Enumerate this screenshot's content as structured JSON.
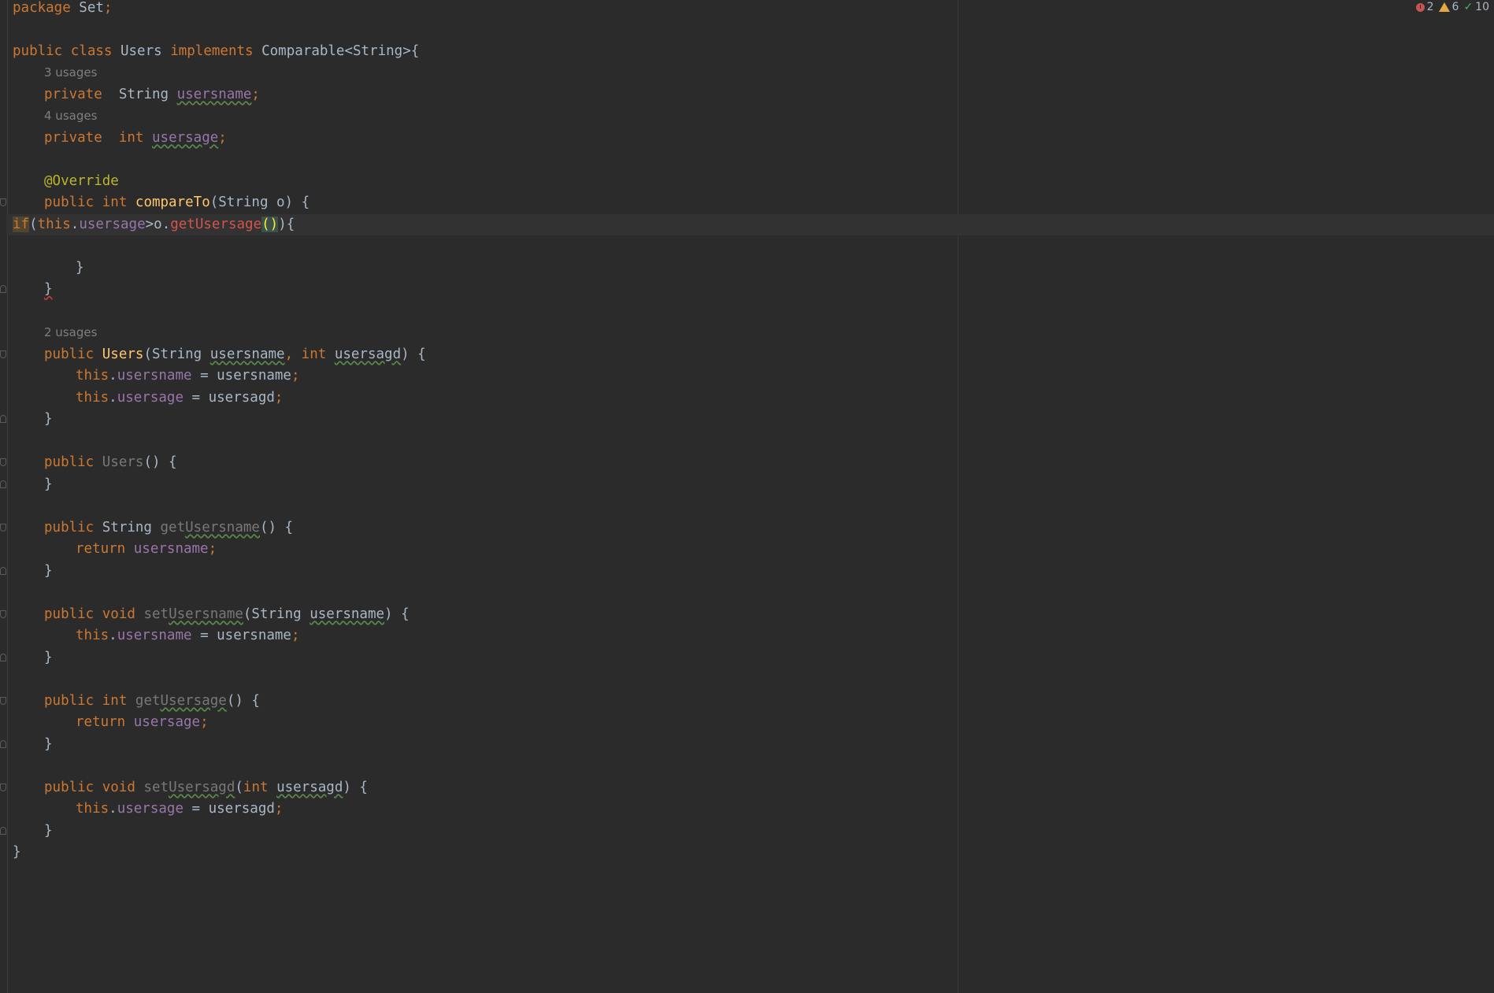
{
  "status": {
    "errors": "2",
    "warnings": "6",
    "typos": "10",
    "colors": {
      "error": "#c75450",
      "warning": "#e5a83f",
      "ok": "#59a869"
    }
  },
  "code": {
    "l01": {
      "a": "package",
      "b": " Set",
      "c": ";"
    },
    "l03": {
      "a": "public class",
      "b": " Users ",
      "c": "implements",
      "d": " Comparable<String>{"
    },
    "h1": "3 usages",
    "l04": {
      "a": "private",
      "b": "  String ",
      "c": "usersname",
      "d": ";"
    },
    "h2": "4 usages",
    "l05": {
      "a": "private",
      "b": "  ",
      "c": "int",
      "d": " ",
      "e": "usersage",
      "f": ";"
    },
    "l07": {
      "a": "@Override"
    },
    "l08": {
      "a": "public int",
      "b": " ",
      "c": "compareTo",
      "d": "(String o) {"
    },
    "l09": {
      "a": "if",
      "b": "(",
      "c": "this",
      "d": ".",
      "e": "usersage",
      "f": ">o.",
      "g": "getUsersage",
      "h": "()",
      "i": "){"
    },
    "l11": {
      "a": "}"
    },
    "l12": {
      "a": "}"
    },
    "h3": "2 usages",
    "l14": {
      "a": "public",
      "b": " ",
      "c": "Users",
      "d": "(String ",
      "e": "usersname",
      "f": ", ",
      "g": "int",
      "h": " ",
      "i": "usersagd",
      "j": ") {"
    },
    "l15": {
      "a": "this",
      "b": ".",
      "c": "usersname",
      "d": " = usersname",
      "e": ";"
    },
    "l16": {
      "a": "this",
      "b": ".",
      "c": "usersage",
      "d": " = usersagd",
      "e": ";"
    },
    "l17": {
      "a": "}"
    },
    "l19": {
      "a": "public",
      "b": " ",
      "c": "Users",
      "d": "() {"
    },
    "l20": {
      "a": "}"
    },
    "l22": {
      "a": "public",
      "b": " String ",
      "c": "get",
      "d": "Usersname",
      "e": "() {"
    },
    "l23": {
      "a": "return",
      "b": " ",
      "c": "usersname",
      "d": ";"
    },
    "l24": {
      "a": "}"
    },
    "l26": {
      "a": "public void",
      "b": " ",
      "c": "set",
      "d": "Usersname",
      "e": "(String ",
      "f": "usersname",
      "g": ") {"
    },
    "l27": {
      "a": "this",
      "b": ".",
      "c": "usersname",
      "d": " = usersname",
      "e": ";"
    },
    "l28": {
      "a": "}"
    },
    "l30": {
      "a": "public int",
      "b": " ",
      "c": "get",
      "d": "Usersage",
      "e": "() {"
    },
    "l31": {
      "a": "return",
      "b": " ",
      "c": "usersage",
      "d": ";"
    },
    "l32": {
      "a": "}"
    },
    "l34": {
      "a": "public void",
      "b": " ",
      "c": "set",
      "d": "Usersagd",
      "e": "(",
      "f": "int",
      "g": " ",
      "h": "usersagd",
      "i": ") {"
    },
    "l35": {
      "a": "this",
      "b": ".",
      "c": "usersage",
      "d": " = usersagd",
      "e": ";"
    },
    "l36": {
      "a": "}"
    },
    "l37": {
      "a": "}"
    }
  }
}
